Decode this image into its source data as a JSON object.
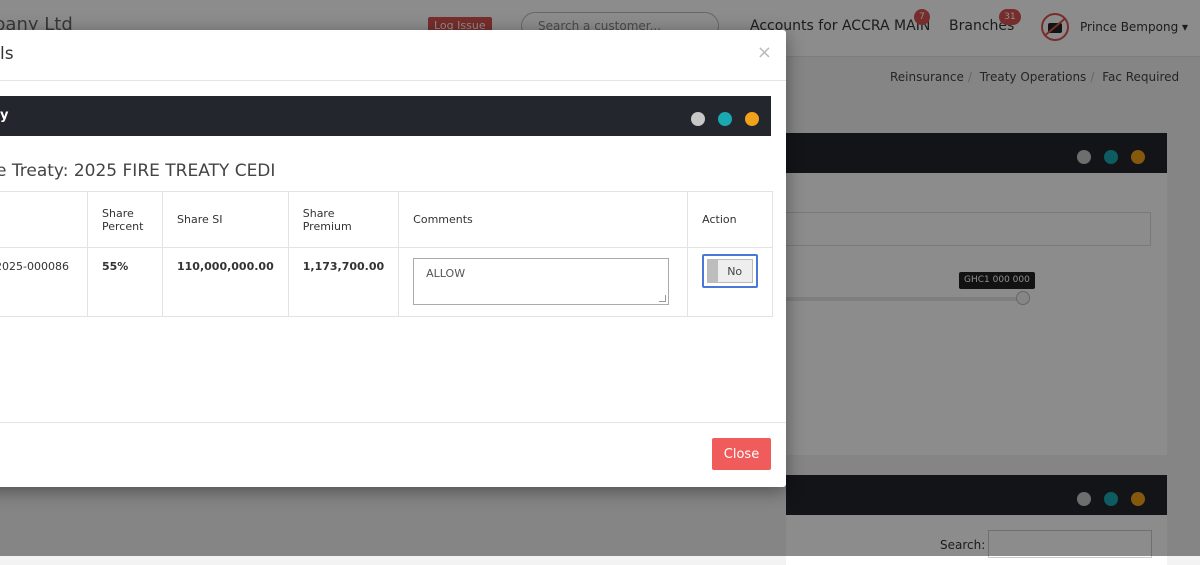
{
  "header": {
    "company_name": "pany Ltd",
    "log_issue_label": "Log Issue",
    "search_placeholder": "Search a customer...",
    "accounts_label": "Accounts for ACCRA MAIN",
    "accounts_badge": "7",
    "branches_label": "Branches",
    "branches_badge": "31",
    "user_name": "Prince Bempong ▾"
  },
  "breadcrumb": [
    "Reinsurance",
    "Treaty Operations",
    "Fac Required"
  ],
  "background": {
    "slider_tooltip": "GHC1 000 000",
    "search_label": "Search:"
  },
  "modal": {
    "title": "ls",
    "close_x": "×",
    "inner_title": "y",
    "treaty_heading": "e Treaty: 2025 FIRE TREATY CEDI",
    "columns": [
      "",
      "Share\nPercent",
      "Share SI",
      "Share\nPremium",
      "Comments",
      "Action"
    ],
    "row": {
      "ref": "2025-000086",
      "share_percent": "55%",
      "share_si": "110,000,000.00",
      "share_premium": "1,173,700.00",
      "comment": "ALLOW",
      "action_toggle": "No"
    },
    "close_button": "Close"
  },
  "colors": {
    "panel_header": "#23262d",
    "close_button": "#f05b5b",
    "badge": "#d9534f",
    "toggle_focus": "#4a78d8"
  }
}
